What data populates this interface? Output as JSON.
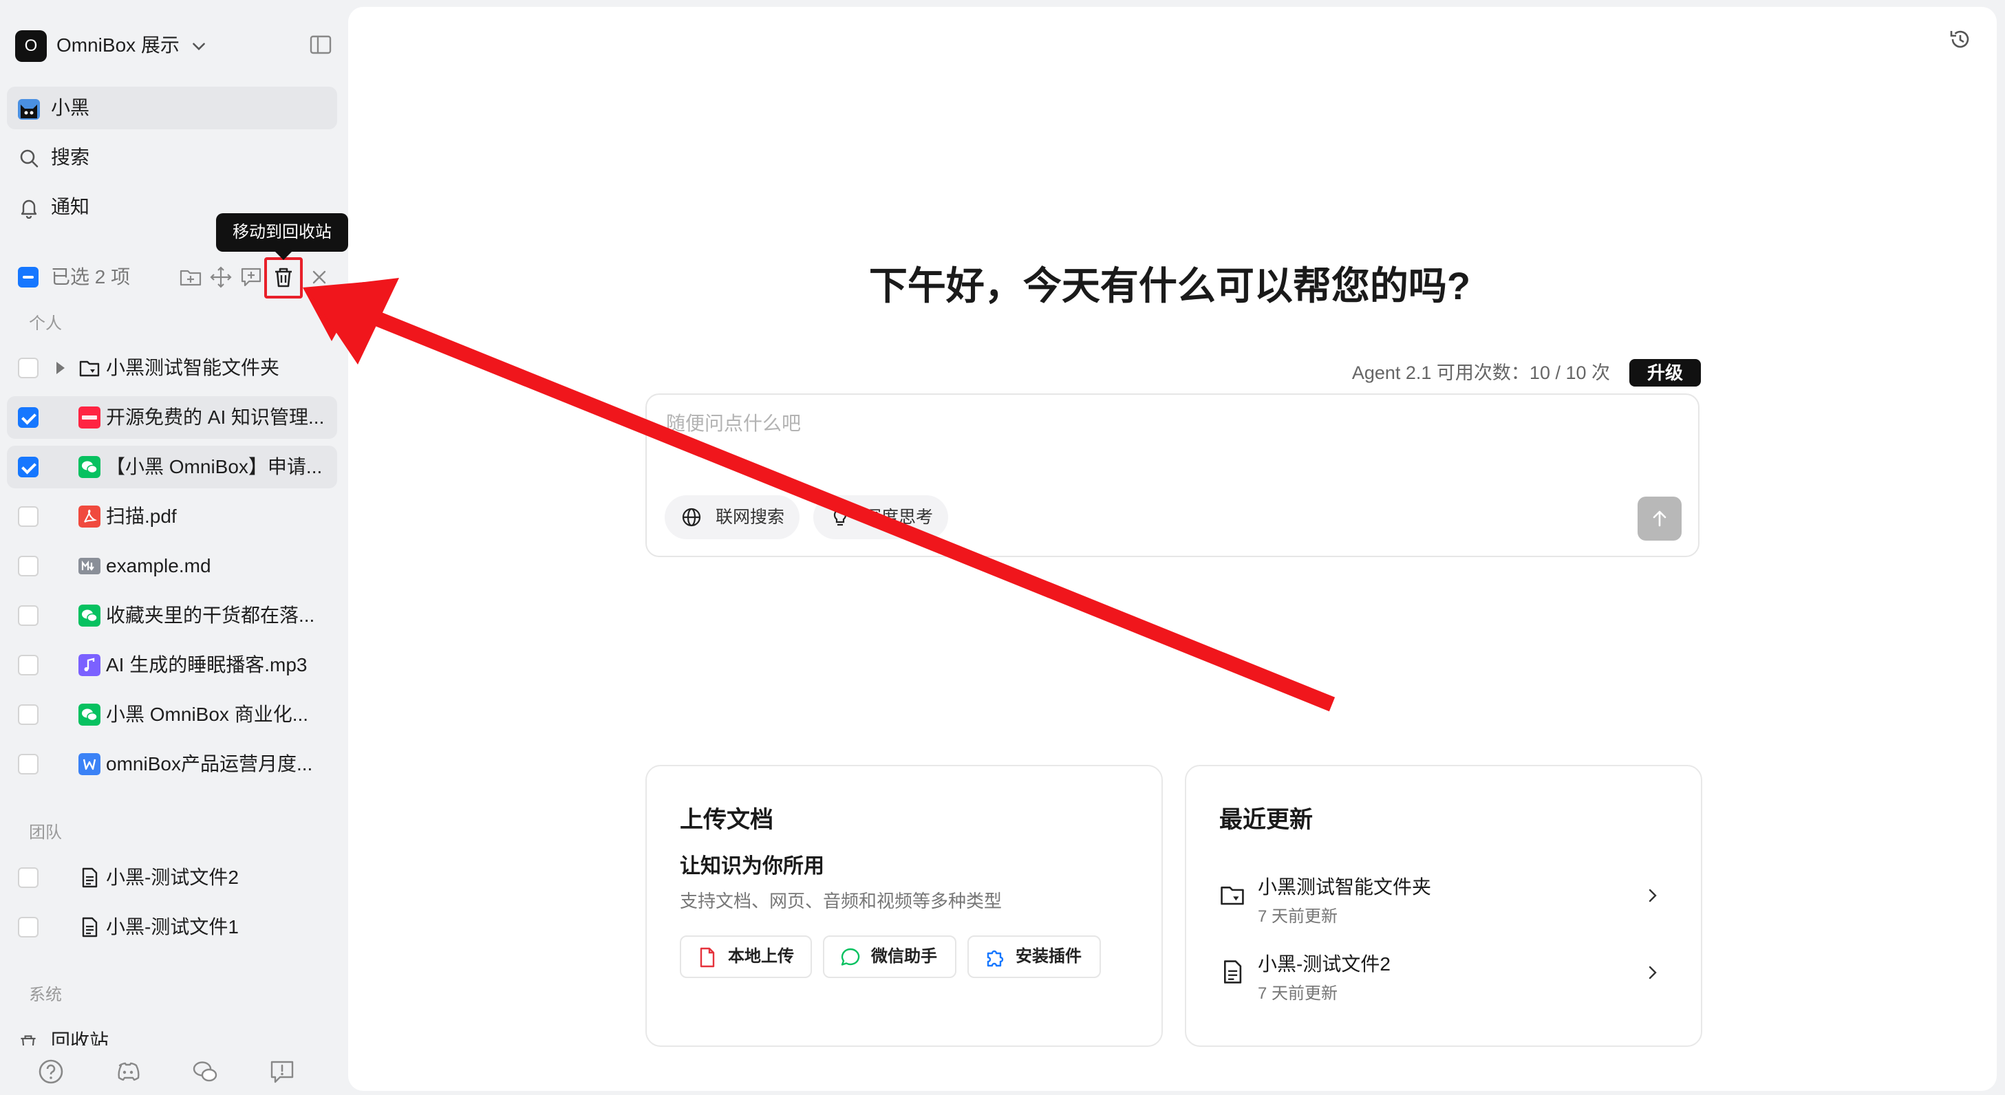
{
  "workspace": {
    "avatar_letter": "O",
    "name": "OmniBox 展示"
  },
  "nav": [
    {
      "label": "小黑"
    },
    {
      "label": "搜索"
    },
    {
      "label": "通知"
    }
  ],
  "selection": {
    "count_label": "已选 2 项",
    "tooltip": "移动到回收站"
  },
  "sections": {
    "personal": "个人",
    "team": "团队",
    "system": "系统"
  },
  "personal_files": [
    {
      "name": "小黑测试智能文件夹",
      "checked": false,
      "icon": "smart-folder-icon"
    },
    {
      "name": "开源免费的 AI 知识管理...",
      "checked": true,
      "icon": "xiaohongshu-icon"
    },
    {
      "name": "【小黑 OmniBox】申请...",
      "checked": true,
      "icon": "wechat-icon"
    },
    {
      "name": "扫描.pdf",
      "checked": false,
      "icon": "pdf-icon"
    },
    {
      "name": "example.md",
      "checked": false,
      "icon": "markdown-icon"
    },
    {
      "name": "收藏夹里的干货都在落...",
      "checked": false,
      "icon": "wechat-icon"
    },
    {
      "name": "AI 生成的睡眠播客.mp3",
      "checked": false,
      "icon": "audio-icon"
    },
    {
      "name": "小黑 OmniBox 商业化...",
      "checked": false,
      "icon": "wechat-icon"
    },
    {
      "name": "omniBox产品运营月度...",
      "checked": false,
      "icon": "word-icon"
    }
  ],
  "team_files": [
    {
      "name": "小黑-测试文件2",
      "checked": false
    },
    {
      "name": "小黑-测试文件1",
      "checked": false
    }
  ],
  "system_files": [
    {
      "name": "回收站"
    }
  ],
  "main": {
    "greeting": "下午好，今天有什么可以帮您的吗?",
    "usage": "Agent 2.1 可用次数：10 / 10 次",
    "upgrade": "升级",
    "input_placeholder": "随便问点什么吧",
    "web_search": "联网搜索",
    "deep_think": "深度思考"
  },
  "upload_card": {
    "title": "上传文档",
    "subtitle": "让知识为你所用",
    "desc": "支持文档、网页、音频和视频等多种类型",
    "buttons": [
      "本地上传",
      "微信助手",
      "安装插件"
    ]
  },
  "recent_card": {
    "title": "最近更新",
    "items": [
      {
        "name": "小黑测试智能文件夹",
        "time": "7 天前更新"
      },
      {
        "name": "小黑-测试文件2",
        "time": "7 天前更新"
      }
    ]
  },
  "colors": {
    "accent": "#1677ff",
    "annotation_red": "#f0161c",
    "dark": "#111111"
  }
}
